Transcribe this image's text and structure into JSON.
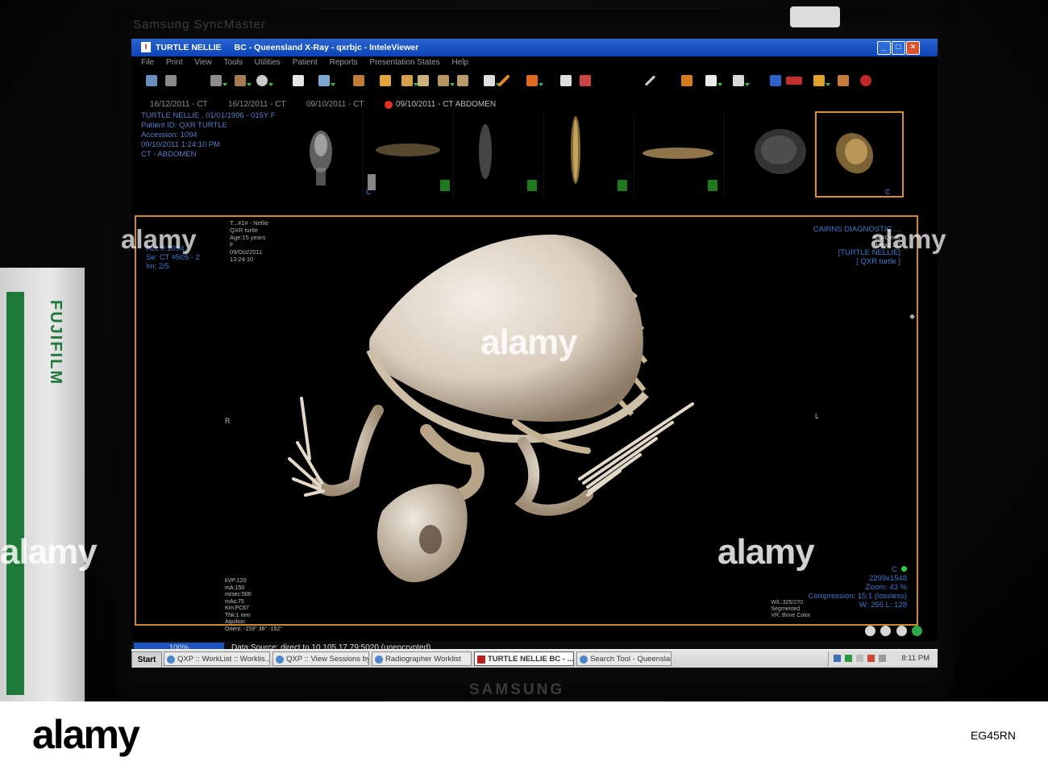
{
  "window": {
    "title_patient": "TURTLE NELLIE",
    "title_rest": "BC - Queensland X-Ray - qxrbjc - InteleViewer"
  },
  "menu": [
    "File",
    "Print",
    "View",
    "Tools",
    "Utilities",
    "Patient",
    "Reports",
    "Presentation States",
    "Help"
  ],
  "study_tabs": [
    "16/12/2011 - CT",
    "16/12/2011 - CT",
    "09/10/2011 - CT",
    "09/10/2011 - CT ABDOMEN"
  ],
  "patient_info": {
    "line1": "TURTLE NELLIE , 01/01/1996 - 015Y F",
    "line2": "Patient ID: QXR TURTLE",
    "line3": "Accession: 1094",
    "line4": "09/10/2011 1:24:10 PM",
    "line5": "CT - ABDOMEN"
  },
  "viewer": {
    "top_left": {
      "acc": "Acc #:1094",
      "se": "Se: CT #505 - 2",
      "im": "Im: 2/5"
    },
    "top_left_small": [
      "T...#1# - Nellie",
      "QXR turtle",
      "Age:15 years",
      "F",
      "09/Oct/2011",
      "13:24:10"
    ],
    "top_right": {
      "line1": "CAIRNS DIAGNOSTIC ...",
      "line2": "[TURTLE NELLIE]",
      "line3": "[ QXR turtle ]"
    },
    "top_right_small": [
      "Abd/Celeff",
      "Head 1.0"
    ],
    "bottom_left_small": [
      "kVP:120",
      "mA:150",
      "mrsec:500",
      "mAs:75",
      "Krn:FC67",
      "Thk:1 mm",
      "Aquilion",
      "Orient: -159° 36° -152°"
    ],
    "bottom_right_small": [
      "W/L:325/270",
      "Segmented",
      "VR: Bone Color"
    ],
    "bottom_right": {
      "c": "C",
      "resolution": "2299x1548",
      "zoom": "Zoom: 43 %",
      "compression": "Compression: 15:1 (lossless)",
      "wl": "W: 255 L: 128"
    },
    "orient_left": "R",
    "orient_right": "L"
  },
  "statusbar": {
    "progress_value": "100%",
    "data_source": "Data Source: direct to 10.105.17.79:5020 (unencrypted)"
  },
  "taskbar": {
    "start": "Start",
    "tasks": [
      "QXP :: WorkList :: Worklis...",
      "QXP :: View Sessions by ...",
      "Radiographer Worklist",
      "TURTLE NELLIE    BC - ...",
      "Search Tool - Queenslan..."
    ],
    "clock": "8:11 PM"
  },
  "bezel": {
    "top_text": "Samsung SyncMaster",
    "brand": "SAMSUNG",
    "side_box_brand": "FUJIFILM"
  },
  "watermark": {
    "main": "alamy",
    "image_id": "EG45RN"
  },
  "colors": {
    "viewer_frame": "#d08a2a",
    "overlay_text": "#3f7ad0",
    "titlebar": "#0b45b8"
  }
}
